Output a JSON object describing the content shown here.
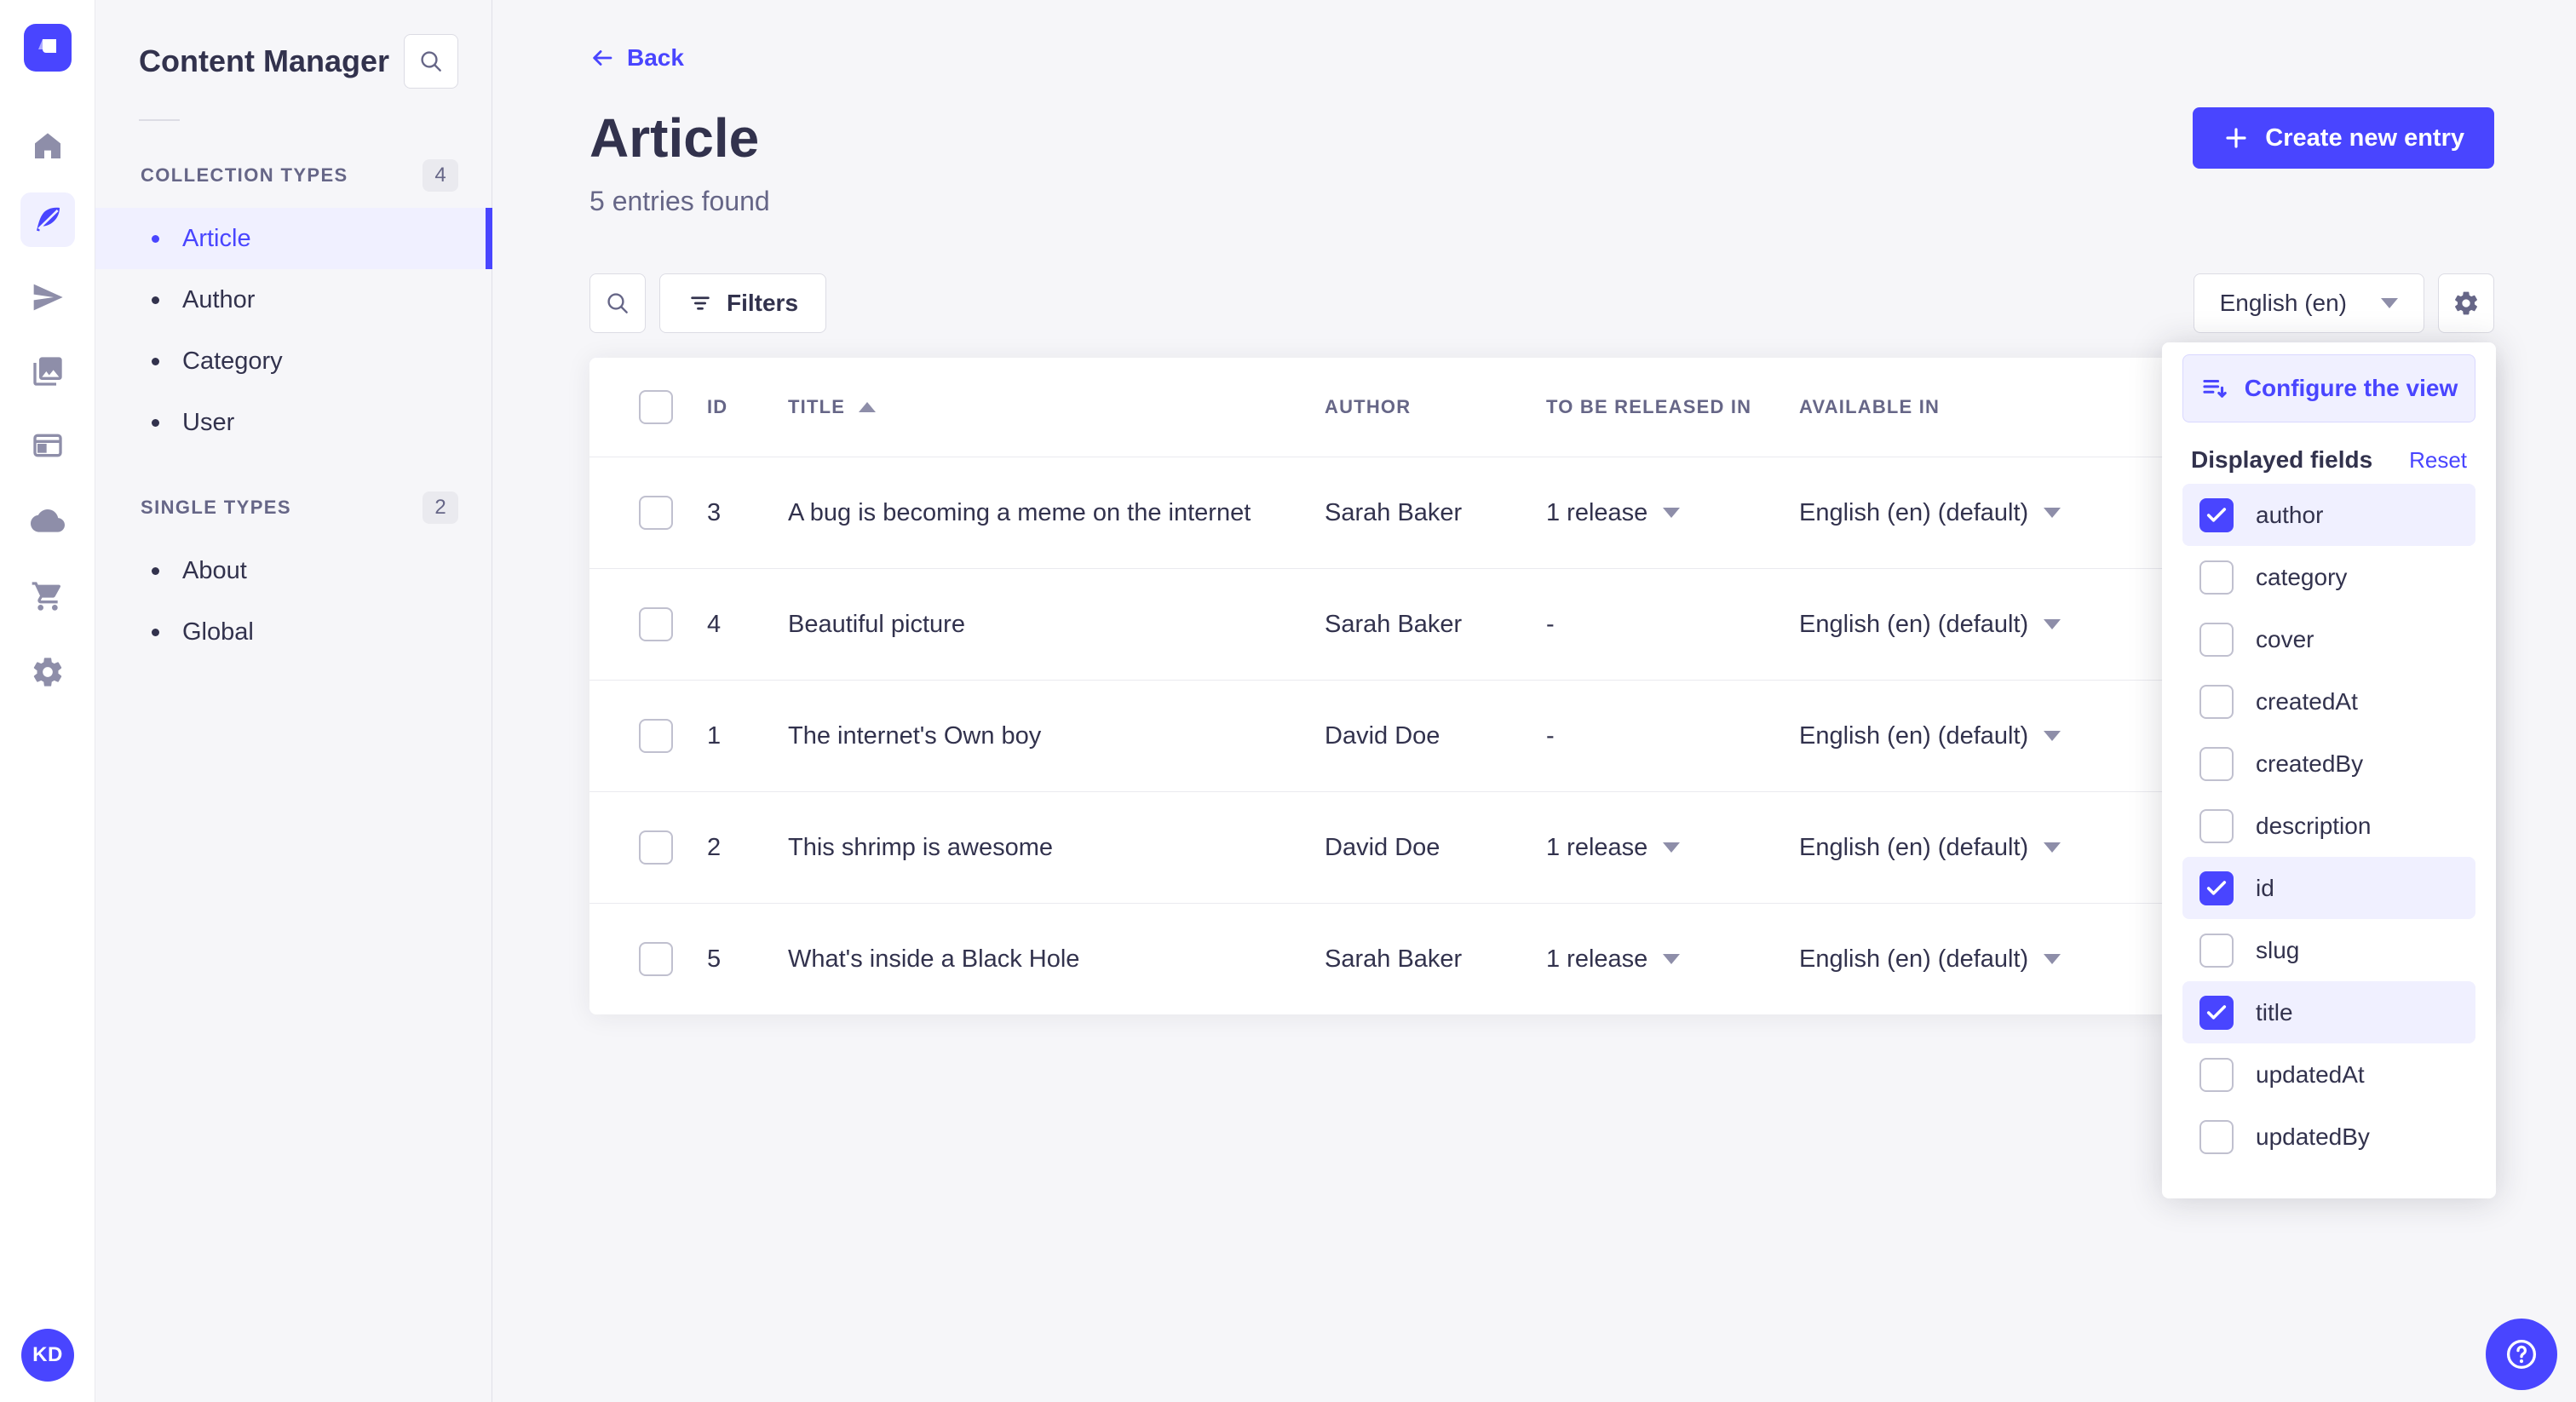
{
  "colors": {
    "primary": "#4945ff",
    "primary_light": "#f0f0ff",
    "text_dark": "#32324d",
    "text_mid": "#666687",
    "background": "#f6f6f9"
  },
  "nav_rail": {
    "icons": [
      "strapi-logo",
      "home-icon",
      "content-manager-feather-icon",
      "send-icon",
      "media-library-icon",
      "layout-icon",
      "cloud-icon",
      "cart-icon",
      "settings-gear-icon"
    ],
    "active_icon": "content-manager-feather-icon"
  },
  "user": {
    "initials": "KD"
  },
  "sidebar": {
    "title": "Content Manager",
    "sections": [
      {
        "label": "COLLECTION TYPES",
        "count": "4",
        "items": [
          {
            "label": "Article",
            "active": true
          },
          {
            "label": "Author",
            "active": false
          },
          {
            "label": "Category",
            "active": false
          },
          {
            "label": "User",
            "active": false
          }
        ]
      },
      {
        "label": "SINGLE TYPES",
        "count": "2",
        "items": [
          {
            "label": "About",
            "active": false
          },
          {
            "label": "Global",
            "active": false
          }
        ]
      }
    ]
  },
  "header": {
    "back_label": "Back",
    "title": "Article",
    "subtitle": "5 entries found",
    "create_button": "Create new entry"
  },
  "toolbar": {
    "filters_label": "Filters",
    "locale_value": "English (en)"
  },
  "table": {
    "columns": {
      "id": "ID",
      "title": "TITLE",
      "author": "AUTHOR",
      "release": "TO BE RELEASED IN",
      "available": "AVAILABLE IN"
    },
    "sorted_column": "TITLE",
    "sort_direction": "asc",
    "rows": [
      {
        "id": "3",
        "title": "A bug is becoming a meme on the internet",
        "author": "Sarah Baker",
        "release": "1 release",
        "available": "English (en) (default)"
      },
      {
        "id": "4",
        "title": "Beautiful picture",
        "author": "Sarah Baker",
        "release": "-",
        "available": "English (en) (default)"
      },
      {
        "id": "1",
        "title": "The internet's Own boy",
        "author": "David Doe",
        "release": "-",
        "available": "English (en) (default)"
      },
      {
        "id": "2",
        "title": "This shrimp is awesome",
        "author": "David Doe",
        "release": "1 release",
        "available": "English (en) (default)"
      },
      {
        "id": "5",
        "title": "What's inside a Black Hole",
        "author": "Sarah Baker",
        "release": "1 release",
        "available": "English (en) (default)"
      }
    ]
  },
  "popover": {
    "configure_label": "Configure the view",
    "fields_title": "Displayed fields",
    "reset_label": "Reset",
    "fields": [
      {
        "label": "author",
        "checked": true
      },
      {
        "label": "category",
        "checked": false
      },
      {
        "label": "cover",
        "checked": false
      },
      {
        "label": "createdAt",
        "checked": false
      },
      {
        "label": "createdBy",
        "checked": false
      },
      {
        "label": "description",
        "checked": false
      },
      {
        "label": "id",
        "checked": true
      },
      {
        "label": "slug",
        "checked": false
      },
      {
        "label": "title",
        "checked": true
      },
      {
        "label": "updatedAt",
        "checked": false
      },
      {
        "label": "updatedBy",
        "checked": false
      }
    ]
  }
}
